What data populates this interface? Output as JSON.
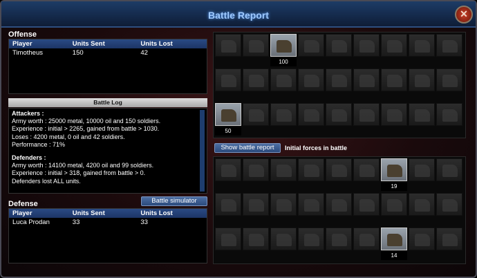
{
  "window": {
    "title": "Battle Report",
    "close_label": "✕"
  },
  "offense": {
    "title": "Offense",
    "headers": [
      "Player",
      "Units Sent",
      "Units Lost"
    ],
    "rows": [
      [
        "Timotheus",
        "150",
        "42"
      ]
    ]
  },
  "battle_log": {
    "title": "Battle Log",
    "lines": [
      "Attackers :",
      "Army worth : 25000 metal, 10000 oil and 150 soldiers.",
      "Experience : initial > 2265, gained from battle > 1030.",
      "Loses : 4200 metal, 0 oil and 42 soldiers.",
      "Performance : 71%",
      "",
      "Defenders :",
      "Army worth : 14100 metal, 4200 oil and 99 soldiers.",
      "Experience : initial > 318, gained from battle > 0.",
      "Defenders lost ALL units."
    ]
  },
  "battle_simulator_label": "Battle simulator",
  "defense": {
    "title": "Defense",
    "headers": [
      "Player",
      "Units Sent",
      "Units Lost"
    ],
    "rows": [
      [
        "Luca Prodan",
        "33",
        "33"
      ]
    ]
  },
  "show_battle_report_label": "Show battle report",
  "initial_forces_label": "Initial forces in battle",
  "attacker_units": [
    {
      "row": 0,
      "col": 2,
      "count": "100",
      "icon": "soldier-icon"
    },
    {
      "row": 2,
      "col": 0,
      "count": "50",
      "icon": "rifleman-icon"
    }
  ],
  "defender_units": [
    {
      "row": 0,
      "col": 6,
      "count": "19",
      "icon": "tank-icon"
    },
    {
      "row": 2,
      "col": 6,
      "count": "14",
      "icon": "artillery-icon"
    }
  ]
}
